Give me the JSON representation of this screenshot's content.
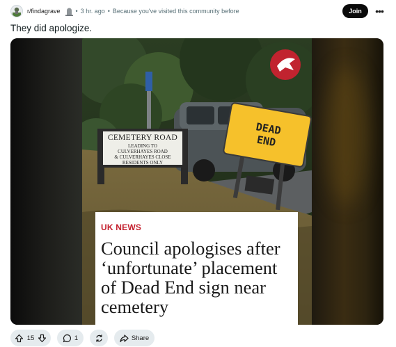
{
  "header": {
    "subreddit": "r/findagrave",
    "separator1": "•",
    "time": "3 hr. ago",
    "separator2": "•",
    "reason": "Because you've visited this community before",
    "join_label": "Join",
    "more_label": "•••"
  },
  "post": {
    "title": "They did apologize."
  },
  "image": {
    "cemetery_sign": {
      "line1": "CEMETERY ROAD",
      "line2": "LEADING TO",
      "line3": "CULVERHAYES ROAD",
      "line4": "& CULVERHAYES CLOSE",
      "line5": "RESIDENTS ONLY"
    },
    "dead_end_sign": {
      "line1": "DEAD",
      "line2": "END"
    },
    "news_label": "UK NEWS",
    "headline": "Council apologises after ‘unfortunate’ placement of Dead End sign near cemetery"
  },
  "actions": {
    "upvote_icon": "arrow-up-icon",
    "vote_count": "15",
    "downvote_icon": "arrow-down-icon",
    "comment_icon": "speech-bubble-icon",
    "comment_count": "1",
    "award_icon": "refresh-icon",
    "share_icon": "share-arrow-icon",
    "share_label": "Share"
  },
  "colors": {
    "join_bg": "#0a0a0a",
    "pill_bg": "#e5ebee",
    "news_label": "#c4202e",
    "dead_end_yellow": "#f6c12b",
    "independent_red": "#c1232f"
  }
}
